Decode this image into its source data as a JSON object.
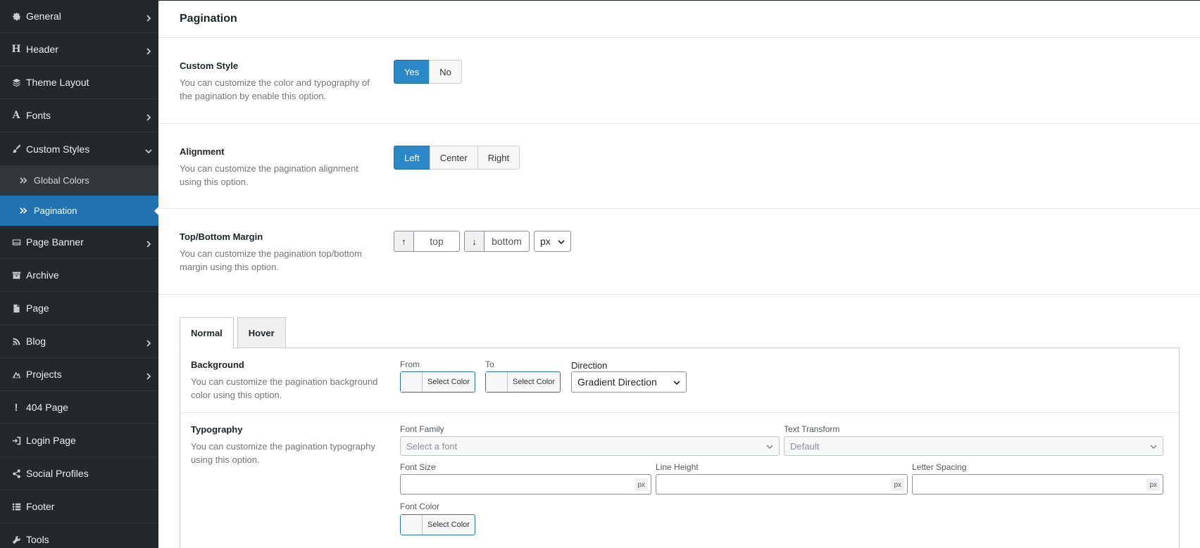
{
  "sidebar": {
    "items": [
      {
        "label": "General",
        "icon": "gear-icon",
        "chevron": "right"
      },
      {
        "label": "Header",
        "icon": "header-h-icon",
        "chevron": "right"
      },
      {
        "label": "Theme Layout",
        "icon": "layers-icon",
        "chevron": ""
      },
      {
        "label": "Fonts",
        "icon": "font-a-icon",
        "chevron": "right"
      },
      {
        "label": "Custom Styles",
        "icon": "brush-icon",
        "chevron": "down"
      }
    ],
    "sub_items": [
      {
        "label": "Global Colors",
        "icon": "double-chevron-icon"
      },
      {
        "label": "Pagination",
        "icon": "double-chevron-icon",
        "active": true
      }
    ],
    "items_after": [
      {
        "label": "Page Banner",
        "icon": "banner-icon",
        "chevron": "right"
      },
      {
        "label": "Archive",
        "icon": "archive-icon",
        "chevron": ""
      },
      {
        "label": "Page",
        "icon": "page-icon",
        "chevron": ""
      },
      {
        "label": "Blog",
        "icon": "blog-icon",
        "chevron": "right"
      },
      {
        "label": "Projects",
        "icon": "projects-icon",
        "chevron": "right"
      },
      {
        "label": "404 Page",
        "icon": "exclamation-icon",
        "chevron": ""
      },
      {
        "label": "Login Page",
        "icon": "login-icon",
        "chevron": ""
      },
      {
        "label": "Social Profiles",
        "icon": "share-icon",
        "chevron": ""
      },
      {
        "label": "Footer",
        "icon": "list-icon",
        "chevron": ""
      },
      {
        "label": "Tools",
        "icon": "wrench-icon",
        "chevron": ""
      }
    ]
  },
  "page": {
    "title": "Pagination"
  },
  "custom_style": {
    "title": "Custom Style",
    "desc": "You can customize the color and typography of the pagination by enable this option.",
    "options": [
      "Yes",
      "No"
    ],
    "selected": "Yes"
  },
  "alignment": {
    "title": "Alignment",
    "desc": "You can customize the pagination alignment using this option.",
    "options": [
      "Left",
      "Center",
      "Right"
    ],
    "selected": "Left"
  },
  "margin": {
    "title": "Top/Bottom Margin",
    "desc": "You can customize the pagination top/bottom margin using this option.",
    "top_icon": "↑",
    "top_placeholder": "top",
    "bottom_icon": "↓",
    "bottom_placeholder": "bottom",
    "unit": "px"
  },
  "tabs": [
    "Normal",
    "Hover"
  ],
  "background": {
    "title": "Background",
    "desc": "You can customize the pagination background color using this option.",
    "from_label": "From",
    "to_label": "To",
    "select_color": "Select Color",
    "direction_label": "Direction",
    "direction_value": "Gradient Direction"
  },
  "typography": {
    "title": "Typography",
    "desc": "You can customize the pagination typography using this option.",
    "font_family_label": "Font Family",
    "font_family_value": "Select a font",
    "text_transform_label": "Text Transform",
    "text_transform_value": "Default",
    "font_size_label": "Font Size",
    "line_height_label": "Line Height",
    "letter_spacing_label": "Letter Spacing",
    "unit": "px",
    "font_color_label": "Font Color",
    "select_color": "Select Color"
  },
  "colors": {
    "sidebar_bg": "#23282d",
    "active": "#2271b1",
    "button_on": "#2a88c8"
  }
}
